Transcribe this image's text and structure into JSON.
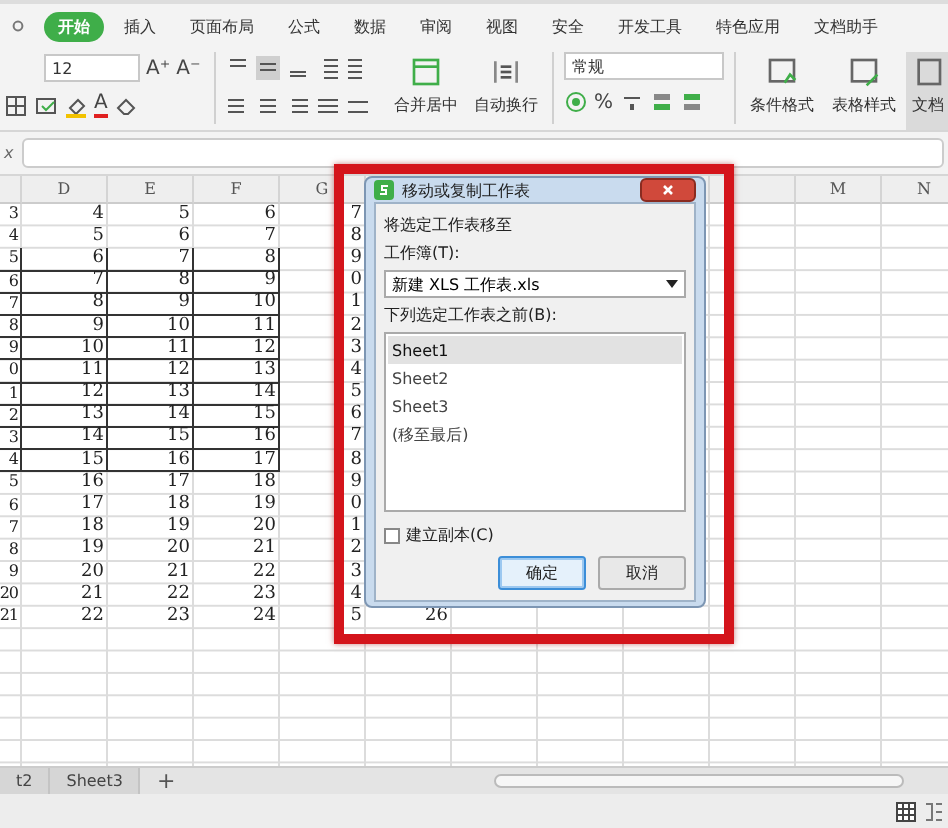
{
  "ribbon_tabs": [
    {
      "label": "开始",
      "selected": true
    },
    {
      "label": "插入",
      "selected": false
    },
    {
      "label": "页面布局",
      "selected": false
    },
    {
      "label": "公式",
      "selected": false
    },
    {
      "label": "数据",
      "selected": false
    },
    {
      "label": "审阅",
      "selected": false
    },
    {
      "label": "视图",
      "selected": false
    },
    {
      "label": "安全",
      "selected": false
    },
    {
      "label": "开发工具",
      "selected": false
    },
    {
      "label": "特色应用",
      "selected": false
    },
    {
      "label": "文档助手",
      "selected": false
    }
  ],
  "ribbon": {
    "font_size": "12",
    "font_buttons": [
      "A⁺",
      "A⁻"
    ],
    "font_color": "A",
    "merge_label": "合并居中",
    "wrap_label": "自动换行",
    "number_format": "常规",
    "percent": "%",
    "cond_label": "条件格式",
    "style_label": "表格样式",
    "helper_label": "文档"
  },
  "formula_bar": {
    "label": "x"
  },
  "columns": [
    {
      "label": "D"
    },
    {
      "label": "E"
    },
    {
      "label": "F"
    },
    {
      "label": "G"
    }
  ],
  "right_columns": [
    {
      "label": "M"
    },
    {
      "label": "N"
    }
  ],
  "rows": [
    {
      "cells": [
        "3",
        "4",
        "5",
        "6",
        "7"
      ],
      "bordered": false
    },
    {
      "cells": [
        "4",
        "5",
        "6",
        "7",
        "8"
      ],
      "bordered": false
    },
    {
      "cells": [
        "5",
        "6",
        "7",
        "8",
        "9"
      ],
      "bordered": true
    },
    {
      "cells": [
        "6",
        "7",
        "8",
        "9",
        "0"
      ],
      "bordered": true
    },
    {
      "cells": [
        "7",
        "8",
        "9",
        "10",
        "1"
      ],
      "bordered": true
    },
    {
      "cells": [
        "8",
        "9",
        "10",
        "11",
        "2"
      ],
      "bordered": true
    },
    {
      "cells": [
        "9",
        "10",
        "11",
        "12",
        "3"
      ],
      "bordered": true
    },
    {
      "cells": [
        "0",
        "11",
        "12",
        "13",
        "4"
      ],
      "bordered": true
    },
    {
      "cells": [
        "1",
        "12",
        "13",
        "14",
        "5"
      ],
      "bordered": true
    },
    {
      "cells": [
        "2",
        "13",
        "14",
        "15",
        "6"
      ],
      "bordered": true
    },
    {
      "cells": [
        "3",
        "14",
        "15",
        "16",
        "7"
      ],
      "bordered": true
    },
    {
      "cells": [
        "4",
        "15",
        "16",
        "17",
        "8"
      ],
      "bordered": true
    },
    {
      "cells": [
        "5",
        "16",
        "17",
        "18",
        "9"
      ],
      "bordered": false
    },
    {
      "cells": [
        "6",
        "17",
        "18",
        "19",
        "0"
      ],
      "bordered": false
    },
    {
      "cells": [
        "7",
        "18",
        "19",
        "20",
        "1"
      ],
      "bordered": false
    },
    {
      "cells": [
        "8",
        "19",
        "20",
        "21",
        "2"
      ],
      "bordered": false
    },
    {
      "cells": [
        "9",
        "20",
        "21",
        "22",
        "3"
      ],
      "bordered": false
    },
    {
      "cells": [
        "20",
        "21",
        "22",
        "23",
        "4"
      ],
      "bordered": false
    },
    {
      "cells": [
        "21",
        "22",
        "23",
        "24",
        "5",
        "26"
      ],
      "bordered": false
    }
  ],
  "dialog": {
    "title": "移动或复制工作表",
    "move_to": "将选定工作表移至",
    "workbook_label": "工作簿(T):",
    "workbook": "新建 XLS 工作表.xls",
    "before_label": "下列选定工作表之前(B):",
    "sheets": [
      {
        "label": "Sheet1",
        "selected": true
      },
      {
        "label": "Sheet2",
        "selected": false
      },
      {
        "label": "Sheet3",
        "selected": false
      },
      {
        "label": "(移至最后)",
        "selected": false
      }
    ],
    "copy": {
      "label": "建立副本(C)",
      "checked": false
    },
    "buttons": [
      {
        "label": "确定",
        "kind": "primary"
      },
      {
        "label": "取消",
        "kind": "secondary"
      }
    ]
  },
  "sheet_tabs": [
    {
      "label": "t2",
      "selected": false
    },
    {
      "label": "Sheet3",
      "selected": false
    }
  ],
  "add_sheet": "+"
}
